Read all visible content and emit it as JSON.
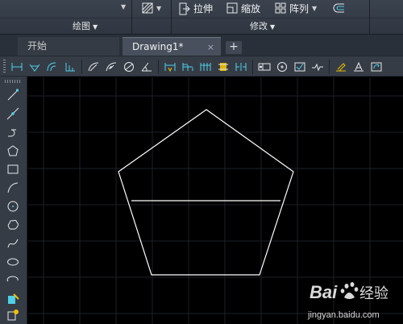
{
  "ribbon": {
    "tools": {
      "stretch": "拉伸",
      "scale": "缩放",
      "array": "阵列"
    },
    "panels": {
      "draw": "绘图",
      "modify": "修改"
    }
  },
  "tabs": [
    {
      "label": "开始",
      "active": false
    },
    {
      "label": "Drawing1*",
      "active": true
    }
  ],
  "tab_add": "+",
  "tab_close": "×",
  "colors": {
    "ribbon_bg": "#333a44",
    "canvas_bg": "#000000",
    "grid": "#1c2028",
    "geometry": "#ffffff",
    "icon_cyan": "#4fd0e8",
    "icon_yellow": "#f0c000"
  },
  "icons": {
    "dim_toolbar": [
      "linear-dim-icon",
      "aligned-dim-icon",
      "arc-length-icon",
      "ordinate-dim-icon",
      "radius-dim-icon",
      "jogged-dim-icon",
      "diameter-dim-icon",
      "angular-dim-icon",
      "quick-dim-icon",
      "baseline-dim-icon",
      "continue-dim-icon",
      "dim-space-icon",
      "dim-break-icon",
      "tolerance-icon",
      "center-mark-icon",
      "inspect-icon",
      "jogged-linear-icon",
      "dim-edit-icon",
      "dim-text-edit-icon",
      "dim-update-icon"
    ],
    "draw_toolbar": [
      "line-icon",
      "construction-line-icon",
      "polyline-icon",
      "polygon-icon",
      "rectangle-icon",
      "arc-icon",
      "circle-icon",
      "revision-cloud-icon",
      "spline-icon",
      "ellipse-icon",
      "ellipse-arc-icon",
      "insert-block-icon",
      "make-block-icon"
    ]
  },
  "watermark": {
    "logo": "Bai du 经验",
    "url": "jingyan.baidu.com"
  }
}
